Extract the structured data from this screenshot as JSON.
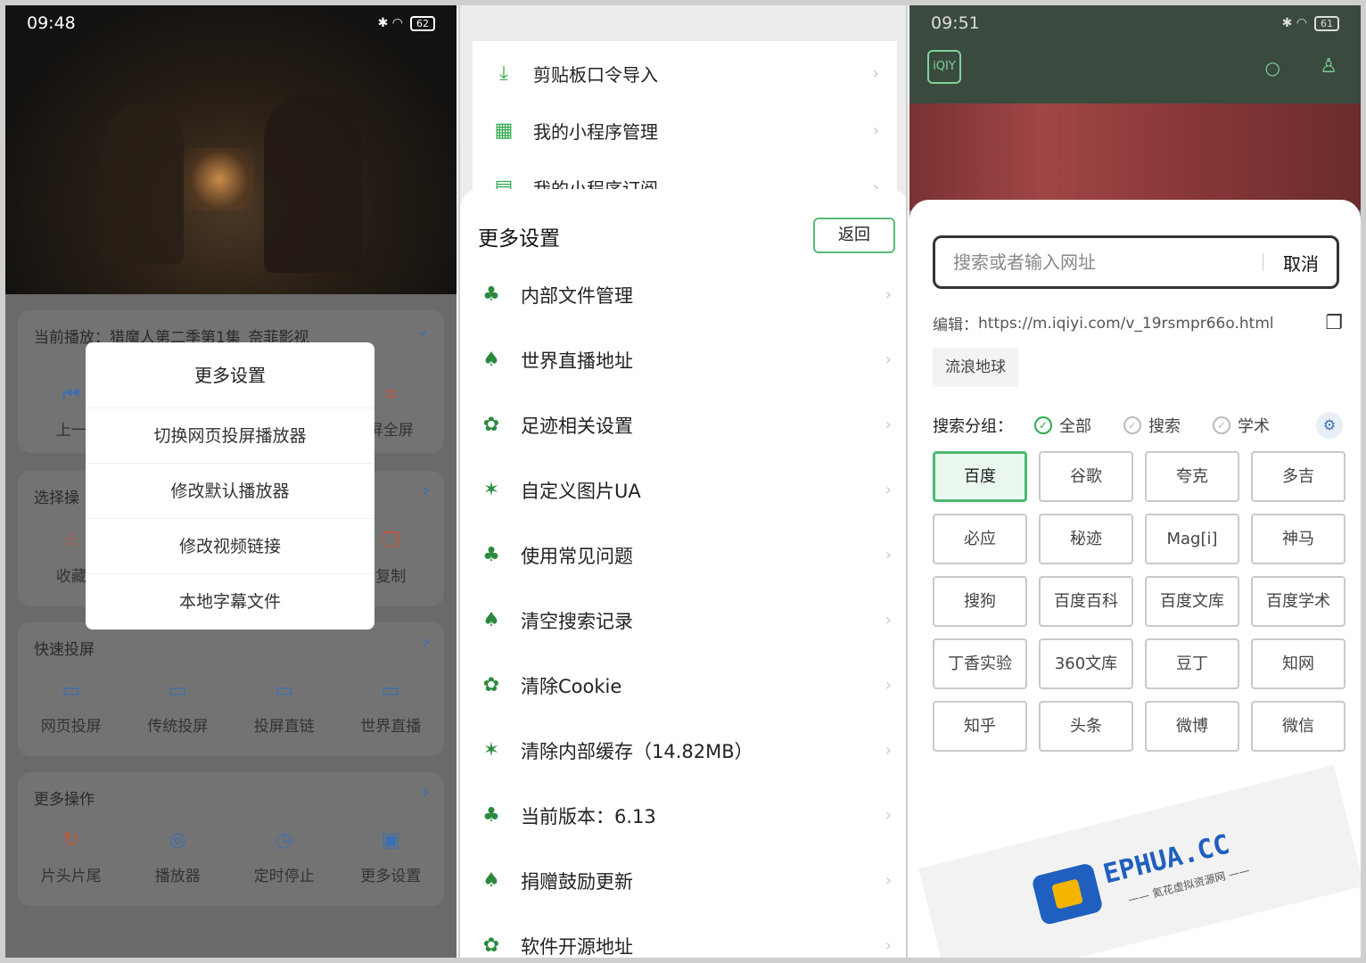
{
  "panel1": {
    "status": {
      "time": "09:48",
      "icons": "bluetooth-wifi",
      "battery": "62"
    },
    "now_playing": "当前播放：猎魔人第二季第1集_奈菲影视",
    "nav_row": {
      "prev": "上一",
      "fullscreen": "屏全屏"
    },
    "select_ops": {
      "title": "选择操",
      "favorite": "收藏",
      "copy": "复制"
    },
    "dialog": {
      "title": "更多设置",
      "items": [
        "切换网页投屏播放器",
        "修改默认播放器",
        "修改视频链接",
        "本地字幕文件"
      ]
    },
    "quick_cast": {
      "title": "快速投屏",
      "items": [
        "网页投屏",
        "传统投屏",
        "投屏直链",
        "世界直播"
      ]
    },
    "more_ops": {
      "title": "更多操作",
      "items": [
        "片头片尾",
        "播放器",
        "定时停止",
        "更多设置"
      ]
    },
    "colors": {
      "accent": "#3b6fb6"
    }
  },
  "panel2": {
    "top_rows": [
      "剪贴板口令导入",
      "我的小程序管理",
      "我的小程序订阅"
    ],
    "sheet_title": "更多设置",
    "back_label": "返回",
    "rows": [
      "内部文件管理",
      "世界直播地址",
      "足迹相关设置",
      "自定义图片UA",
      "使用常见问题",
      "清空搜索记录",
      "清除Cookie",
      "清除内部缓存（14.82MB）",
      "当前版本：6.13",
      "捐赠鼓励更新",
      "软件开源地址"
    ],
    "colors": {
      "accent": "#2fa84f"
    }
  },
  "panel3": {
    "status": {
      "time": "09:51",
      "battery": "61"
    },
    "logo_text": "iQIY",
    "search": {
      "placeholder": "搜索或者输入网址",
      "cancel": "取消"
    },
    "edit": {
      "label": "编辑：",
      "url": "https://m.iqiyi.com/v_19rsmpr66o.html"
    },
    "history_chip": "流浪地球",
    "group": {
      "label": "搜索分组：",
      "options": [
        "全部",
        "搜索",
        "学术"
      ],
      "selected": "全部"
    },
    "engines": [
      "百度",
      "谷歌",
      "夸克",
      "多吉",
      "必应",
      "秘迹",
      "Mag[i]",
      "神马",
      "搜狗",
      "百度百科",
      "百度文库",
      "百度学术",
      "丁香实验",
      "360文库",
      "豆丁",
      "知网",
      "知乎",
      "头条",
      "微博",
      "微信"
    ],
    "selected_engine": "百度",
    "watermark": {
      "brand": "EPHUA.CC",
      "sub": "—— 氦花虚拟资源网 ——"
    },
    "colors": {
      "accent": "#4cb873"
    }
  }
}
